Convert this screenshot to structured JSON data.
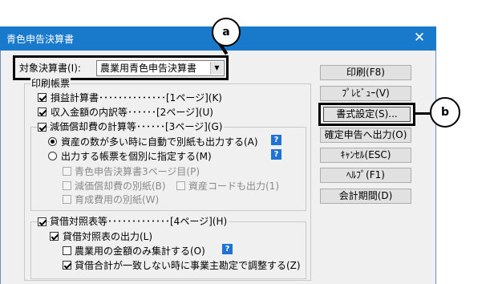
{
  "window": {
    "title": "青色申告決算書",
    "close": "✕"
  },
  "target": {
    "label": "対象決算書(I):",
    "value": "農業用青色申告決算書"
  },
  "print_group": {
    "label": "印刷帳票"
  },
  "items": {
    "income_statement": "損益計算書･･････････････[1ページ](K)",
    "revenue_breakdown": "収入金額の内訳等･･････[2ページ](U)",
    "depreciation": "減価償却費の計算等･･････[3ページ](G)",
    "radio_auto": "資産の数が多い時に自動で別紙も出力する(A)",
    "radio_manual": "出力する帳票を個別に指定する(M)",
    "blue_page3": "青色申告決算書3ページ目(P)",
    "depr_separate": "減価償却費の別紙(B)",
    "asset_code": "資産コードも出力(1)",
    "growing_cost": "育成費用の別紙(W)",
    "balance_sheet": "貸借対照表等･････････････[4ページ](H)",
    "bs_output": "貸借対照表の出力(L)",
    "agri_only": "農業用の金額のみ集計する(O)",
    "mismatch_adjust": "貸借合計が一致しない時に事業主勘定で調整する(Z)"
  },
  "help_mark": "?",
  "buttons": {
    "print": "印刷(F8)",
    "preview": "ﾌﾟﾚﾋﾞｭｰ(V)",
    "format": "書式設定(S)...",
    "output_confirm": "確定申告へ出力(O)",
    "cancel": "ｷｬﾝｾﾙ(ESC)",
    "help": "ﾍﾙﾌﾟ(F1)",
    "period": "会計期間(D)"
  },
  "callouts": {
    "a": "a",
    "b": "b"
  }
}
